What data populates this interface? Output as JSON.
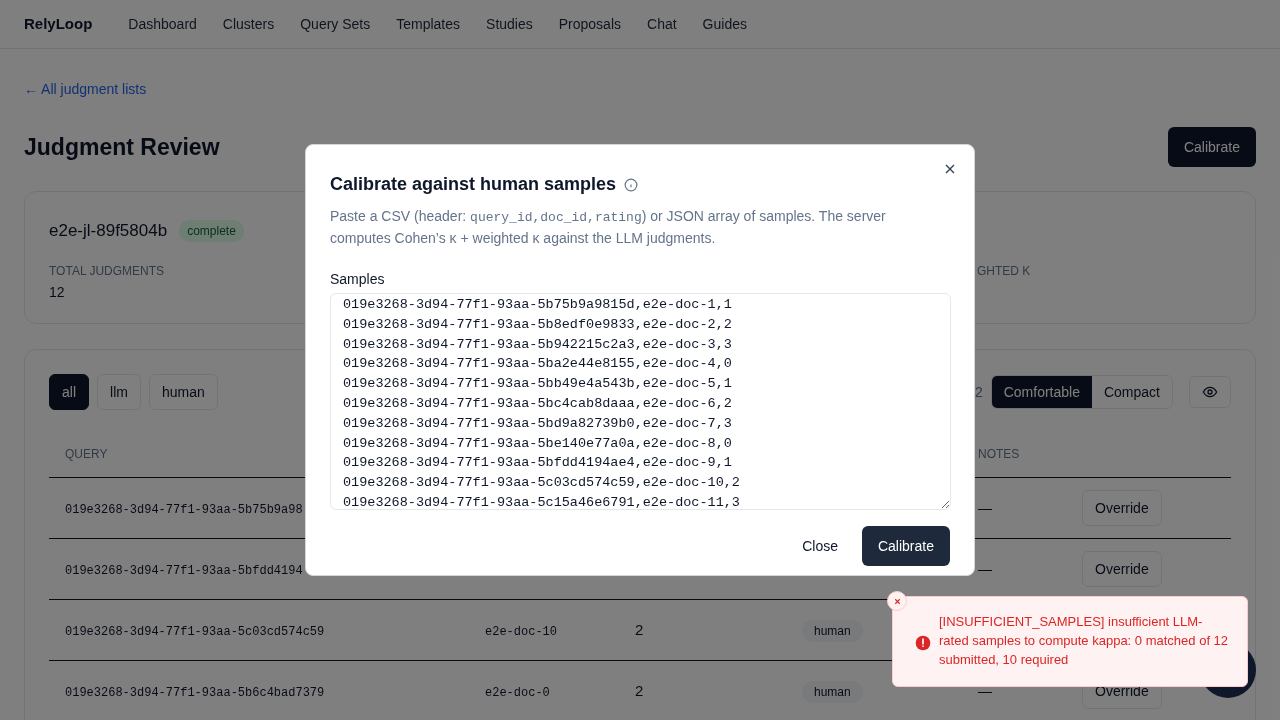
{
  "nav": {
    "brand": "RelyLoop",
    "items": [
      "Dashboard",
      "Clusters",
      "Query Sets",
      "Templates",
      "Studies",
      "Proposals",
      "Chat",
      "Guides"
    ]
  },
  "back_link": "← All judgment lists",
  "page_title": "Judgment Review",
  "header_button": "Calibrate",
  "summary": {
    "name": "e2e-jl-89f5804b",
    "status": "complete",
    "stats": [
      {
        "label": "TOTAL JUDGMENTS",
        "value": "12"
      },
      {
        "label": "GHTED K"
      }
    ]
  },
  "filters": [
    {
      "label": "all",
      "selected": true
    },
    {
      "label": "llm",
      "selected": false
    },
    {
      "label": "human",
      "selected": false
    }
  ],
  "count_fragment": "2",
  "density": [
    {
      "label": "Comfortable",
      "selected": true
    },
    {
      "label": "Compact",
      "selected": false
    }
  ],
  "table": {
    "columns": [
      "QUERY",
      "NOTES"
    ],
    "rows": [
      {
        "query": "019e3268-3d94-77f1-93aa-5b75b9a98",
        "notes": "—",
        "action": "Override"
      },
      {
        "query": "019e3268-3d94-77f1-93aa-5bfdd4194",
        "notes": "—",
        "action": "Override"
      },
      {
        "query": "019e3268-3d94-77f1-93aa-5c03cd574c59",
        "doc": "e2e-doc-10",
        "rating": "2",
        "source": "human"
      },
      {
        "query": "019e3268-3d94-77f1-93aa-5b6c4bad7379",
        "doc": "e2e-doc-0",
        "rating": "2",
        "source": "human",
        "notes": "—",
        "action": "Override"
      }
    ]
  },
  "modal": {
    "title": "Calibrate against human samples",
    "description": [
      {
        "kind": "text",
        "text": "Paste a CSV (header: "
      },
      {
        "kind": "code",
        "text": "query_id,doc_id,rating"
      },
      {
        "kind": "text",
        "text": ") or JSON array of samples. The server computes Cohen’s κ + weighted κ against the LLM judgments."
      }
    ],
    "field_label": "Samples",
    "samples": [
      "019e3268-3d94-77f1-93aa-5b75b9a9815d,e2e-doc-1,1",
      "019e3268-3d94-77f1-93aa-5b8edf0e9833,e2e-doc-2,2",
      "019e3268-3d94-77f1-93aa-5b942215c2a3,e2e-doc-3,3",
      "019e3268-3d94-77f1-93aa-5ba2e44e8155,e2e-doc-4,0",
      "019e3268-3d94-77f1-93aa-5bb49e4a543b,e2e-doc-5,1",
      "019e3268-3d94-77f1-93aa-5bc4cab8daaa,e2e-doc-6,2",
      "019e3268-3d94-77f1-93aa-5bd9a82739b0,e2e-doc-7,3",
      "019e3268-3d94-77f1-93aa-5be140e77a0a,e2e-doc-8,0",
      "019e3268-3d94-77f1-93aa-5bfdd4194ae4,e2e-doc-9,1",
      "019e3268-3d94-77f1-93aa-5c03cd574c59,e2e-doc-10,2",
      "019e3268-3d94-77f1-93aa-5c15a46e6791,e2e-doc-11,3"
    ],
    "buttons": [
      {
        "kind": "secondary",
        "label": "Close"
      },
      {
        "kind": "primary",
        "label": "Calibrate"
      }
    ]
  },
  "toast": {
    "message": "[INSUFFICIENT_SAMPLES] insufficient LLM-rated samples to compute kappa: 0 matched of 12 submitted, 10 required"
  }
}
